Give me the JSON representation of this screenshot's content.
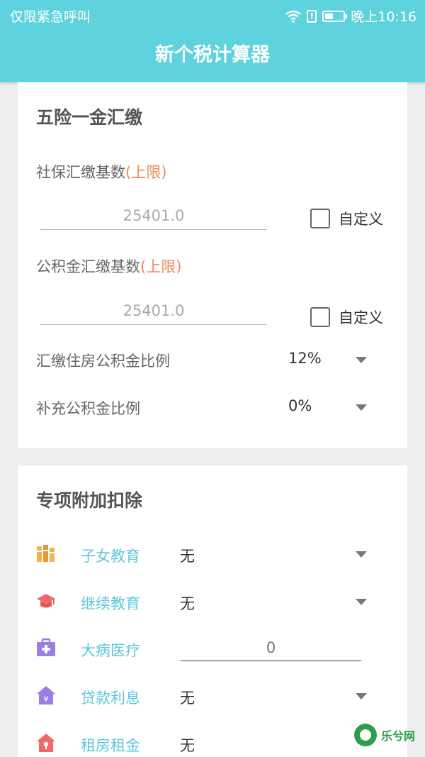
{
  "status_bar": {
    "carrier": "仅限紧急呼叫",
    "time": "晚上10:16"
  },
  "app_bar": {
    "title": "新个税计算器"
  },
  "insurance": {
    "title": "五险一金汇缴",
    "social_base": {
      "label": "社保汇缴基数",
      "hint": "(上限)",
      "placeholder": "25401.0",
      "custom_label": "自定义"
    },
    "fund_base": {
      "label": "公积金汇缴基数",
      "hint": "(上限)",
      "placeholder": "25401.0",
      "custom_label": "自定义"
    },
    "fund_ratio": {
      "label": "汇缴住房公积金比例",
      "value": "12%"
    },
    "supp_ratio": {
      "label": "补充公积金比例",
      "value": "0%"
    }
  },
  "deductions": {
    "title": "专项附加扣除",
    "items": [
      {
        "icon": "books-icon",
        "label": "子女教育",
        "value": "无"
      },
      {
        "icon": "graduation-cap-icon",
        "label": "继续教育",
        "value": "无"
      },
      {
        "icon": "medical-kit-icon",
        "label": "大病医疗",
        "placeholder": "0"
      },
      {
        "icon": "house-yen-icon",
        "label": "贷款利息",
        "value": "无"
      },
      {
        "icon": "house-key-icon",
        "label": "租房租金",
        "value": "无"
      }
    ]
  },
  "watermark": {
    "text": "乐兮网"
  },
  "colors": {
    "accent": "#5fd3dd",
    "highlight": "#ee8a5a",
    "item_label": "#5fc8d8"
  }
}
